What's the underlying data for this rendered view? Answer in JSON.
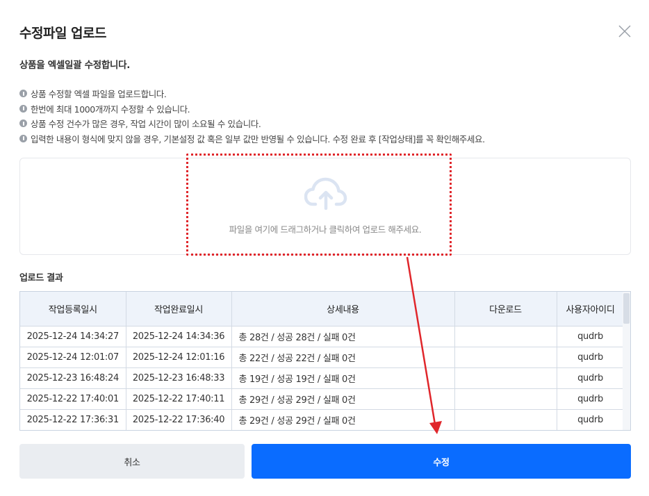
{
  "dialog": {
    "title": "수정파일 업로드",
    "subtitle": "상품을 엑셀일괄 수정합니다."
  },
  "notices": [
    "상품 수정할 엑셀 파일을 업로드합니다.",
    "한번에 최대 1000개까지 수정할 수 있습니다.",
    "상품 수정 건수가 많은 경우, 작업 시간이 많이 소요될 수 있습니다.",
    "입력한 내용이 형식에 맞지 않을 경우, 기본설정 값 혹은 일부 값만 반영될 수 있습니다. 수정 완료 후 [작업상태]를 꼭 확인해주세요."
  ],
  "dropzone": {
    "text": "파일을 여기에 드래그하거나 클릭하여 업로드 해주세요."
  },
  "results": {
    "title": "업로드 결과",
    "columns": [
      "작업등록일시",
      "작업완료일시",
      "상세내용",
      "다운로드",
      "사용자아이디"
    ],
    "rows": [
      [
        "2025-12-24 14:34:27",
        "2025-12-24 14:34:36",
        "총 28건 / 성공 28건 / 실패 0건",
        "",
        "qudrb"
      ],
      [
        "2025-12-24 12:01:07",
        "2025-12-24 12:01:16",
        "총 22건 / 성공 22건 / 실패 0건",
        "",
        "qudrb"
      ],
      [
        "2025-12-23 16:48:24",
        "2025-12-23 16:48:33",
        "총 19건 / 성공 19건 / 실패 0건",
        "",
        "qudrb"
      ],
      [
        "2025-12-22 17:40:01",
        "2025-12-22 17:40:11",
        "총 29건 / 성공 29건 / 실패 0건",
        "",
        "qudrb"
      ],
      [
        "2025-12-22 17:36:31",
        "2025-12-22 17:36:40",
        "총 29건 / 성공 29건 / 실패 0건",
        "",
        "qudrb"
      ]
    ]
  },
  "buttons": {
    "cancel": "취소",
    "submit": "수정"
  },
  "colors": {
    "primary": "#0a6cff",
    "annotation": "#e0262b",
    "table_header": "#eef3fa"
  },
  "icons": {
    "close": "close-icon",
    "info": "info-icon",
    "upload": "cloud-upload-icon"
  }
}
